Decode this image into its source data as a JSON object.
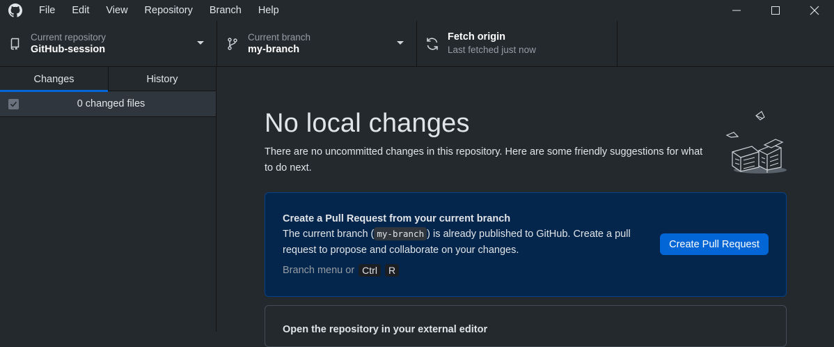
{
  "menu": {
    "items": [
      "File",
      "Edit",
      "View",
      "Repository",
      "Branch",
      "Help"
    ]
  },
  "icons": {
    "app_logo": "github-octocat-icon",
    "minimize": "minimize-icon",
    "maximize": "maximize-icon",
    "close": "close-icon",
    "repo": "repository-icon",
    "branch": "git-branch-icon",
    "fetch": "sync-icon"
  },
  "toolbar": {
    "repo_label": "Current repository",
    "repo_value": "GitHub-session",
    "branch_label": "Current branch",
    "branch_value": "my-branch",
    "fetch_title": "Fetch origin",
    "fetch_status": "Last fetched just now"
  },
  "sidebar": {
    "tabs": [
      {
        "label": "Changes",
        "active": true
      },
      {
        "label": "History",
        "active": false
      }
    ],
    "changes_count_label": "0 changed files"
  },
  "main": {
    "title": "No local changes",
    "intro": "There are no uncommitted changes in this repository. Here are some friendly suggestions for what to do next.",
    "pr_card": {
      "title": "Create a Pull Request from your current branch",
      "desc_before": "The current branch (",
      "desc_branch": "my-branch",
      "desc_after": ") is already published to GitHub. Create a pull request to propose and collaborate on your changes.",
      "hint_prefix": "Branch menu or",
      "hint_key1": "Ctrl",
      "hint_key2": "R",
      "button_label": "Create Pull Request"
    },
    "editor_card": {
      "title": "Open the repository in your external editor"
    }
  },
  "colors": {
    "background": "#24292e",
    "accent": "#0366d6",
    "pr_card_bg": "#05264c",
    "pr_card_border": "#044289"
  }
}
